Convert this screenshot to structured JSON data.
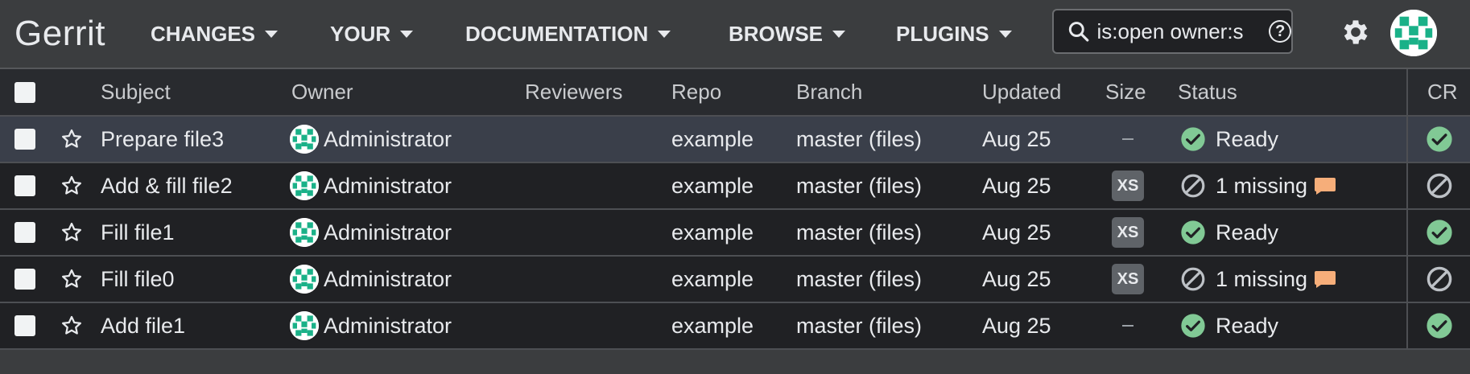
{
  "app": {
    "brand": "Gerrit",
    "nav": [
      "CHANGES",
      "YOUR",
      "DOCUMENTATION",
      "BROWSE",
      "PLUGINS"
    ],
    "search_value": "is:open owner:s",
    "help_label": "?"
  },
  "columns": [
    "Subject",
    "Owner",
    "Reviewers",
    "Repo",
    "Branch",
    "Updated",
    "Size",
    "Status",
    "CR"
  ],
  "rows": [
    {
      "subject": "Prepare file3",
      "owner": "Administrator",
      "reviewers": "",
      "repo": "example",
      "branch": "master (files)",
      "updated": "Aug 25",
      "size": "–",
      "status": "Ready",
      "status_kind": "ready",
      "cr": "approved",
      "selected": true
    },
    {
      "subject": "Add & fill file2",
      "owner": "Administrator",
      "reviewers": "",
      "repo": "example",
      "branch": "master (files)",
      "updated": "Aug 25",
      "size": "XS",
      "status": "1 missing",
      "status_kind": "missing",
      "cr": "blocked",
      "selected": false
    },
    {
      "subject": "Fill file1",
      "owner": "Administrator",
      "reviewers": "",
      "repo": "example",
      "branch": "master (files)",
      "updated": "Aug 25",
      "size": "XS",
      "status": "Ready",
      "status_kind": "ready",
      "cr": "approved",
      "selected": false
    },
    {
      "subject": "Fill file0",
      "owner": "Administrator",
      "reviewers": "",
      "repo": "example",
      "branch": "master (files)",
      "updated": "Aug 25",
      "size": "XS",
      "status": "1 missing",
      "status_kind": "missing",
      "cr": "blocked",
      "selected": false
    },
    {
      "subject": "Add file1",
      "owner": "Administrator",
      "reviewers": "",
      "repo": "example",
      "branch": "master (files)",
      "updated": "Aug 25",
      "size": "–",
      "status": "Ready",
      "status_kind": "ready",
      "cr": "approved",
      "selected": false
    }
  ],
  "colors": {
    "ready": "#81c995",
    "comment": "#f6ae7a",
    "accent": "#1ab188"
  }
}
